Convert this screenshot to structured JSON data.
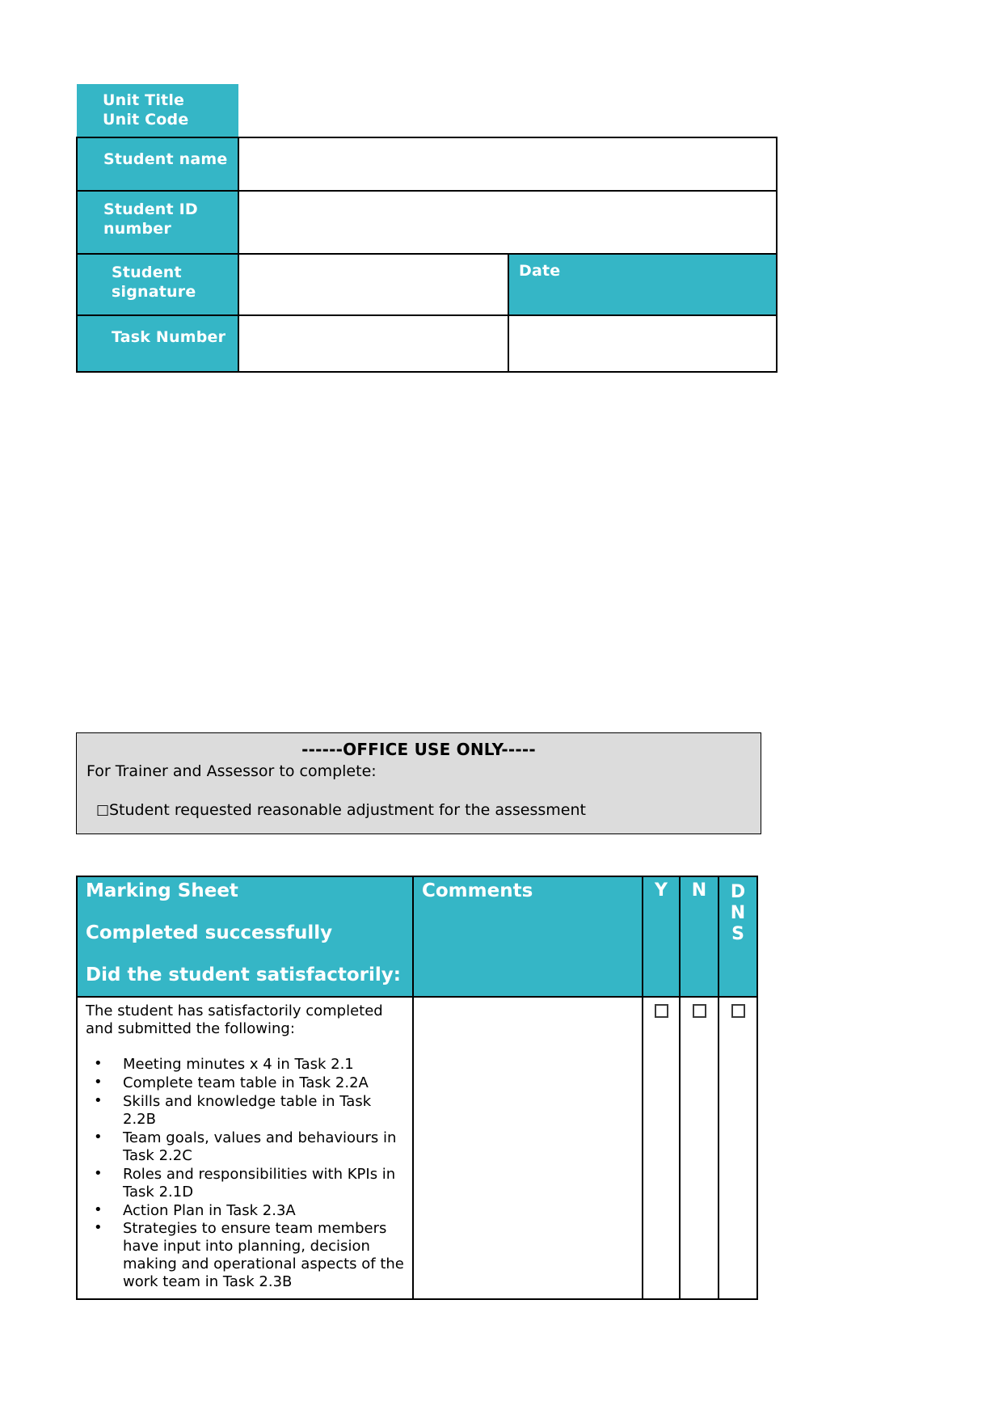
{
  "details": {
    "unit_title_label": "Unit Title",
    "unit_code_label": "Unit Code",
    "student_name_label": "Student name",
    "student_id_label_line1": "Student ID",
    "student_id_label_line2": "number",
    "student_signature_label_line1": "Student",
    "student_signature_label_line2": "signature",
    "date_label": "Date",
    "task_number_label": "Task Number",
    "student_name_value": "",
    "student_id_value": "",
    "student_signature_value": "",
    "date_value": "",
    "task_number_value": "",
    "header_color": "#35b6c6"
  },
  "office_use": {
    "title": "------OFFICE USE ONLY-----",
    "subtitle": "For Trainer and Assessor to complete:",
    "checkbox_glyph": "□",
    "checkbox_label": "Student requested reasonable adjustment for the assessment",
    "background_color": "#dcdcdc"
  },
  "marking_sheet": {
    "header": {
      "line1": "Marking Sheet",
      "line2": "Completed successfully",
      "line3": "Did the student satisfactorily:",
      "comments": "Comments",
      "col_y": "Y",
      "col_n": "N",
      "col_dns_d": "D",
      "col_dns_n": "N",
      "col_dns_s": "S"
    },
    "rows": [
      {
        "intro": "The student has satisfactorily completed and submitted the following:",
        "bullets": [
          "Meeting minutes x 4 in Task 2.1",
          "Complete team table in Task 2.2A",
          "Skills and knowledge table in Task 2.2B",
          "Team goals, values and behaviours in Task 2.2C",
          "Roles and responsibilities with KPIs in Task 2.1D",
          "Action Plan in Task 2.3A",
          "Strategies to ensure team members have input into planning, decision making and operational aspects of the work team in Task 2.3B"
        ],
        "comments_value": "",
        "y_checked": false,
        "n_checked": false,
        "dns_checked": false
      }
    ]
  }
}
